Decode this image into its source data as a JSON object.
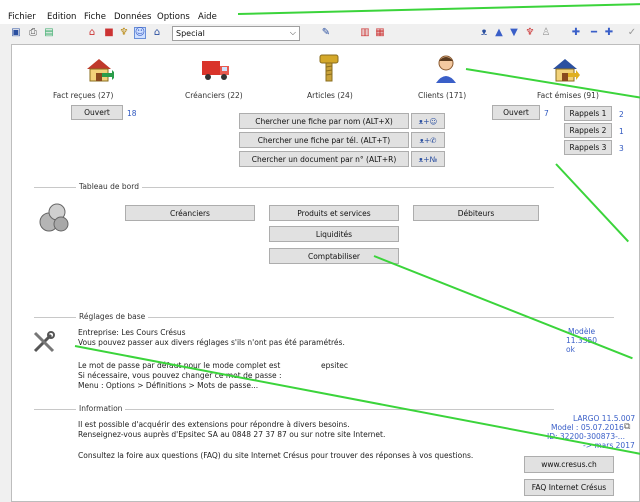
{
  "menubar": {
    "items": [
      "Fichier",
      "Edition",
      "Fiche",
      "Données",
      "Options",
      "Aide"
    ]
  },
  "toolbar": {
    "mode_select": "Special"
  },
  "modules": [
    {
      "label": "Fact reçues (27)",
      "icon": "house-arrow-icon"
    },
    {
      "label": "Créanciers (22)",
      "icon": "truck-icon"
    },
    {
      "label": "Articles (24)",
      "icon": "screw-icon"
    },
    {
      "label": "Clients (171)",
      "icon": "person-icon"
    },
    {
      "label": "Fact émises (91)",
      "icon": "house-arrow-out-icon"
    }
  ],
  "left_open": {
    "label": "Ouvert",
    "count": "18"
  },
  "right_open": {
    "label": "Ouvert",
    "count": "7"
  },
  "rappels": [
    {
      "label": "Rappels 1",
      "count": "2"
    },
    {
      "label": "Rappels 2",
      "count": "1"
    },
    {
      "label": "Rappels 3",
      "count": "3"
    }
  ],
  "search_buttons": [
    "Chercher une fiche par nom (ALT+X)",
    "Chercher une fiche par tél. (ALT+T)",
    "Chercher un document par n° (ALT+R)"
  ],
  "dashboard": {
    "title": "Tableau de bord",
    "creanciers": "Créanciers",
    "produits": "Produits et services",
    "debiteurs": "Débiteurs",
    "liquidites": "Liquidités",
    "comptabiliser": "Comptabiliser"
  },
  "reglages": {
    "title": "Réglages de base",
    "line1": "Entreprise: Les Cours Crésus",
    "line2": "Vous pouvez passer aux divers réglages s'ils n'ont pas été paramétrés.",
    "line3": "Le mot de passe par défaut pour le mode complet est",
    "password": "epsitec",
    "line4": "Si nécessaire, vous pouvez changer ce mot de passe :",
    "line5": "Menu : Options > Définitions > Mots de passe...",
    "model_label": "Modèle",
    "model_version": "11.3350",
    "model_status": "ok"
  },
  "information": {
    "title": "Information",
    "line1": "Il est possible d'acquérir des extensions pour répondre à divers besoins.",
    "line2": "Renseignez-vous auprès d'Epsitec SA au 0848 27 37 87 ou sur notre site Internet.",
    "line3": "Consultez la foire aux questions (FAQ) du site Internet Crésus pour trouver des réponses à vos questions.",
    "version": "LARGO 11.5.007",
    "model_date": "Model : 05.07.2016",
    "id": "ID: 32200-300873-...",
    "expiry": "-> mars 2017",
    "website_button": "www.cresus.ch",
    "faq_button": "FAQ Internet Crésus"
  },
  "colors": {
    "annotation_line": "#3bd43b",
    "link_blue": "#3a5fc8"
  }
}
